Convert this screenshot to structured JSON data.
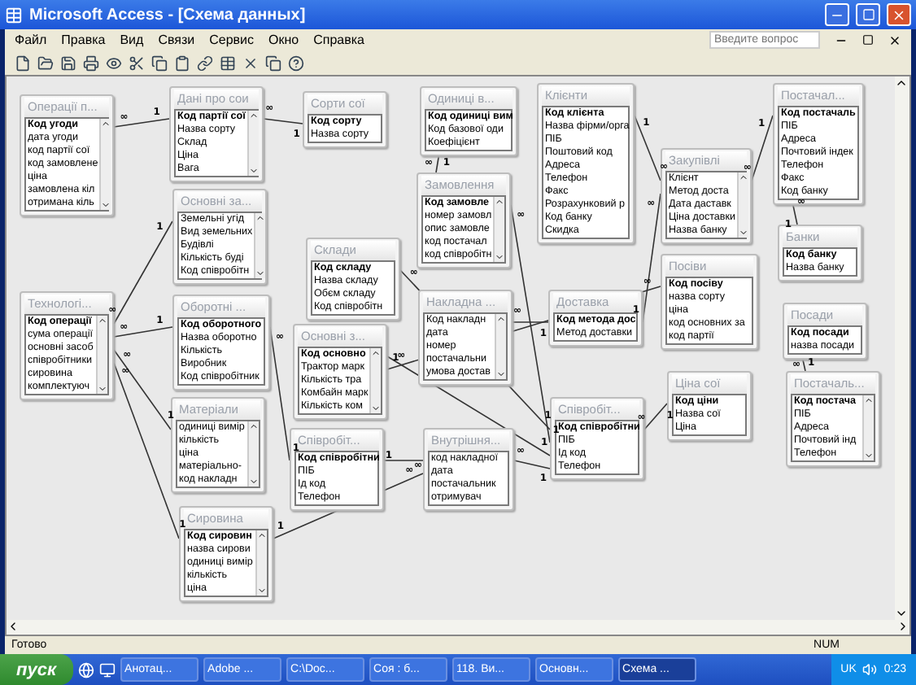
{
  "window": {
    "title": "Microsoft Access - [Схема данных]"
  },
  "menu": [
    "Файл",
    "Правка",
    "Вид",
    "Связи",
    "Сервис",
    "Окно",
    "Справка"
  ],
  "help_search": {
    "placeholder": "Введите вопрос"
  },
  "tables": [
    {
      "title": "Операції п...",
      "scrollbar": true,
      "fields": [
        {
          "name": "Код угоди",
          "key": true
        },
        {
          "name": "дата угоди",
          "key": false
        },
        {
          "name": "код партії сої",
          "key": false
        },
        {
          "name": "код замовлене",
          "key": false
        },
        {
          "name": "ціна",
          "key": false
        },
        {
          "name": "замовлена кіл",
          "key": false
        },
        {
          "name": "отримана кіль",
          "key": false
        }
      ]
    },
    {
      "title": "Дані про сои",
      "scrollbar": true,
      "fields": [
        {
          "name": "Код партії сої",
          "key": true
        },
        {
          "name": "Назва сорту",
          "key": false
        },
        {
          "name": "Склад",
          "key": false
        },
        {
          "name": "Ціна",
          "key": false
        },
        {
          "name": "Вага",
          "key": false
        }
      ]
    },
    {
      "title": "Сорти сої",
      "scrollbar": false,
      "fields": [
        {
          "name": "Код сорту",
          "key": true
        },
        {
          "name": "Назва сорту",
          "key": false
        }
      ]
    },
    {
      "title": "Одиниці в...",
      "scrollbar": false,
      "fields": [
        {
          "name": "Код одиниці вим",
          "key": true
        },
        {
          "name": "Код базової оди",
          "key": false
        },
        {
          "name": "Коефіцієнт",
          "key": false
        }
      ]
    },
    {
      "title": "Клієнти",
      "scrollbar": false,
      "fields": [
        {
          "name": "Код клієнта",
          "key": true
        },
        {
          "name": "Назва фірми/орга",
          "key": false
        },
        {
          "name": "ПІБ",
          "key": false
        },
        {
          "name": "Поштовий код",
          "key": false
        },
        {
          "name": "Адреса",
          "key": false
        },
        {
          "name": "Телефон",
          "key": false
        },
        {
          "name": "Факс",
          "key": false
        },
        {
          "name": "Розрахунковий р",
          "key": false
        },
        {
          "name": "Код банку",
          "key": false
        },
        {
          "name": "Скидка",
          "key": false
        }
      ]
    },
    {
      "title": "Постачал...",
      "scrollbar": false,
      "fields": [
        {
          "name": "Код постачаль",
          "key": true
        },
        {
          "name": "ПІБ",
          "key": false
        },
        {
          "name": "Адреса",
          "key": false
        },
        {
          "name": "Почтовий індек",
          "key": false
        },
        {
          "name": "Телефон",
          "key": false
        },
        {
          "name": "Факс",
          "key": false
        },
        {
          "name": "Код банку",
          "key": false
        }
      ]
    },
    {
      "title": "Основні за...",
      "scrollbar": true,
      "fields": [
        {
          "name": "Земельні угід",
          "key": false
        },
        {
          "name": "Вид земельних",
          "key": false
        },
        {
          "name": "Будівлі",
          "key": false
        },
        {
          "name": "Кількість буді",
          "key": false
        },
        {
          "name": "Код співробітн",
          "key": false
        }
      ]
    },
    {
      "title": "Замовлення",
      "scrollbar": true,
      "fields": [
        {
          "name": "Код замовле",
          "key": true
        },
        {
          "name": "номер замовл",
          "key": false
        },
        {
          "name": "опис замовле",
          "key": false
        },
        {
          "name": "код постачал",
          "key": false
        },
        {
          "name": "код співробітн",
          "key": false
        }
      ]
    },
    {
      "title": "Закупівлі",
      "scrollbar": true,
      "fields": [
        {
          "name": "Клієнт",
          "key": false
        },
        {
          "name": "Метод доста",
          "key": false
        },
        {
          "name": "Дата даставк",
          "key": false
        },
        {
          "name": "Ціна доставки",
          "key": false
        },
        {
          "name": "Назва банку",
          "key": false
        }
      ]
    },
    {
      "title": "Склади",
      "scrollbar": false,
      "fields": [
        {
          "name": "Код складу",
          "key": true
        },
        {
          "name": "Назва складу",
          "key": false
        },
        {
          "name": "Обєм складу",
          "key": false
        },
        {
          "name": "Код співробітн",
          "key": false
        }
      ]
    },
    {
      "title": "Технологі...",
      "scrollbar": true,
      "fields": [
        {
          "name": "Код операції",
          "key": true
        },
        {
          "name": "сума операції",
          "key": false
        },
        {
          "name": "основні засоб",
          "key": false
        },
        {
          "name": "співробітники",
          "key": false
        },
        {
          "name": "сировина",
          "key": false
        },
        {
          "name": "комплектуюч",
          "key": false
        }
      ]
    },
    {
      "title": "Оборотні ...",
      "scrollbar": false,
      "fields": [
        {
          "name": "Код оборотного",
          "key": true
        },
        {
          "name": "Назва оборотно",
          "key": false
        },
        {
          "name": "Кількість",
          "key": false
        },
        {
          "name": "Виробник",
          "key": false
        },
        {
          "name": "Код співробітник",
          "key": false
        }
      ]
    },
    {
      "title": "Накладна ...",
      "scrollbar": true,
      "fields": [
        {
          "name": "Код накладн",
          "key": false
        },
        {
          "name": "дата",
          "key": false
        },
        {
          "name": "номер",
          "key": false
        },
        {
          "name": "постачальни",
          "key": false
        },
        {
          "name": "умова достав",
          "key": false
        }
      ]
    },
    {
      "title": "Доставка",
      "scrollbar": false,
      "fields": [
        {
          "name": "Код метода дос",
          "key": true
        },
        {
          "name": "Метод доставки",
          "key": false
        }
      ]
    },
    {
      "title": "Посіви",
      "scrollbar": false,
      "fields": [
        {
          "name": "Код посіву",
          "key": true
        },
        {
          "name": "назва сорту",
          "key": false
        },
        {
          "name": "ціна",
          "key": false
        },
        {
          "name": "код основних за",
          "key": false
        },
        {
          "name": "код партії",
          "key": false
        }
      ]
    },
    {
      "title": "Банки",
      "scrollbar": false,
      "fields": [
        {
          "name": "Код банку",
          "key": true
        },
        {
          "name": "Назва банку",
          "key": false
        }
      ]
    },
    {
      "title": "Посади",
      "scrollbar": false,
      "fields": [
        {
          "name": "Код посади",
          "key": true
        },
        {
          "name": "назва посади",
          "key": false
        }
      ]
    },
    {
      "title": "Основні з...",
      "scrollbar": true,
      "fields": [
        {
          "name": "Код основно",
          "key": true
        },
        {
          "name": "Трактор марк",
          "key": false
        },
        {
          "name": "Кількість тра",
          "key": false
        },
        {
          "name": "Комбайн марк",
          "key": false
        },
        {
          "name": "Кількість ком",
          "key": false
        }
      ]
    },
    {
      "title": "Матеріали",
      "scrollbar": true,
      "fields": [
        {
          "name": "одиниці вимір",
          "key": false
        },
        {
          "name": "кількість",
          "key": false
        },
        {
          "name": "ціна",
          "key": false
        },
        {
          "name": "матеріально-",
          "key": false
        },
        {
          "name": "код накладн",
          "key": false
        }
      ]
    },
    {
      "title": "Співробіт...",
      "scrollbar": false,
      "fields": [
        {
          "name": "Код співробітни",
          "key": true
        },
        {
          "name": "ПІБ",
          "key": false
        },
        {
          "name": "Ід код",
          "key": false
        },
        {
          "name": "Телефон",
          "key": false
        }
      ]
    },
    {
      "title": "Внутрішня...",
      "scrollbar": false,
      "fields": [
        {
          "name": "код накладної",
          "key": false
        },
        {
          "name": "дата",
          "key": false
        },
        {
          "name": "постачальник",
          "key": false
        },
        {
          "name": "отримувач",
          "key": false
        }
      ]
    },
    {
      "title": "Співробіт...",
      "scrollbar": false,
      "fields": [
        {
          "name": "Код співробітни",
          "key": true
        },
        {
          "name": "ПІБ",
          "key": false
        },
        {
          "name": "Ід код",
          "key": false
        },
        {
          "name": "Телефон",
          "key": false
        }
      ]
    },
    {
      "title": "Ціна сої",
      "scrollbar": false,
      "fields": [
        {
          "name": "Код ціни",
          "key": true
        },
        {
          "name": "Назва сої",
          "key": false
        },
        {
          "name": "Ціна",
          "key": false
        }
      ]
    },
    {
      "title": "Постачаль...",
      "scrollbar": true,
      "fields": [
        {
          "name": "Код постача",
          "key": true
        },
        {
          "name": "ПІБ",
          "key": false
        },
        {
          "name": "Адреса",
          "key": false
        },
        {
          "name": "Почтовий інд",
          "key": false
        },
        {
          "name": "Телефон",
          "key": false
        }
      ]
    },
    {
      "title": "Сировина",
      "scrollbar": true,
      "fields": [
        {
          "name": "Код сировин",
          "key": true
        },
        {
          "name": "назва сирови",
          "key": false
        },
        {
          "name": "одиниці вимір",
          "key": false
        },
        {
          "name": "кількість",
          "key": false
        },
        {
          "name": "ціна",
          "key": false
        }
      ]
    }
  ],
  "relationships": [
    {
      "from_label": "1",
      "to_label": "∞"
    },
    {
      "from_label": "1",
      "to_label": "∞"
    },
    {
      "from_label": "1",
      "to_label": "∞"
    },
    {
      "from_label": "1",
      "to_label": "∞"
    },
    {
      "from_label": "1",
      "to_label": "∞"
    },
    {
      "from_label": "1",
      "to_label": "∞"
    },
    {
      "from_label": "1",
      "to_label": "∞"
    },
    {
      "from_label": "1",
      "to_label": "∞"
    },
    {
      "from_label": "1",
      "to_label": "∞"
    },
    {
      "from_label": "1",
      "to_label": "∞"
    },
    {
      "from_label": "1",
      "to_label": "∞"
    },
    {
      "from_label": "1",
      "to_label": "∞"
    },
    {
      "from_label": "1",
      "to_label": "∞"
    },
    {
      "from_label": "1",
      "to_label": "∞"
    },
    {
      "from_label": "1",
      "to_label": "∞"
    },
    {
      "from_label": "1",
      "to_label": "∞"
    },
    {
      "from_label": "1",
      "to_label": "∞"
    },
    {
      "from_label": "1",
      "to_label": "∞"
    },
    {
      "from_label": "1",
      "to_label": "∞"
    },
    {
      "from_label": "1",
      "to_label": "∞"
    },
    {
      "from_label": "1",
      "to_label": "∞"
    },
    {
      "from_label": "1",
      "to_label": "∞"
    }
  ],
  "status_bar": {
    "text": "Готово",
    "indicator": "NUM"
  },
  "taskbar": {
    "start": "пуск",
    "tasks": [
      {
        "label": "Анотац...",
        "selected": false
      },
      {
        "label": "Adobe ...",
        "selected": false
      },
      {
        "label": "C:\\Doc...",
        "selected": false
      },
      {
        "label": "Соя : б...",
        "selected": false
      },
      {
        "label": "118. Ви...",
        "selected": false
      },
      {
        "label": "Основн...",
        "selected": false
      },
      {
        "label": "Схема ...",
        "selected": true
      }
    ],
    "language": "UK",
    "clock": "0:23"
  }
}
